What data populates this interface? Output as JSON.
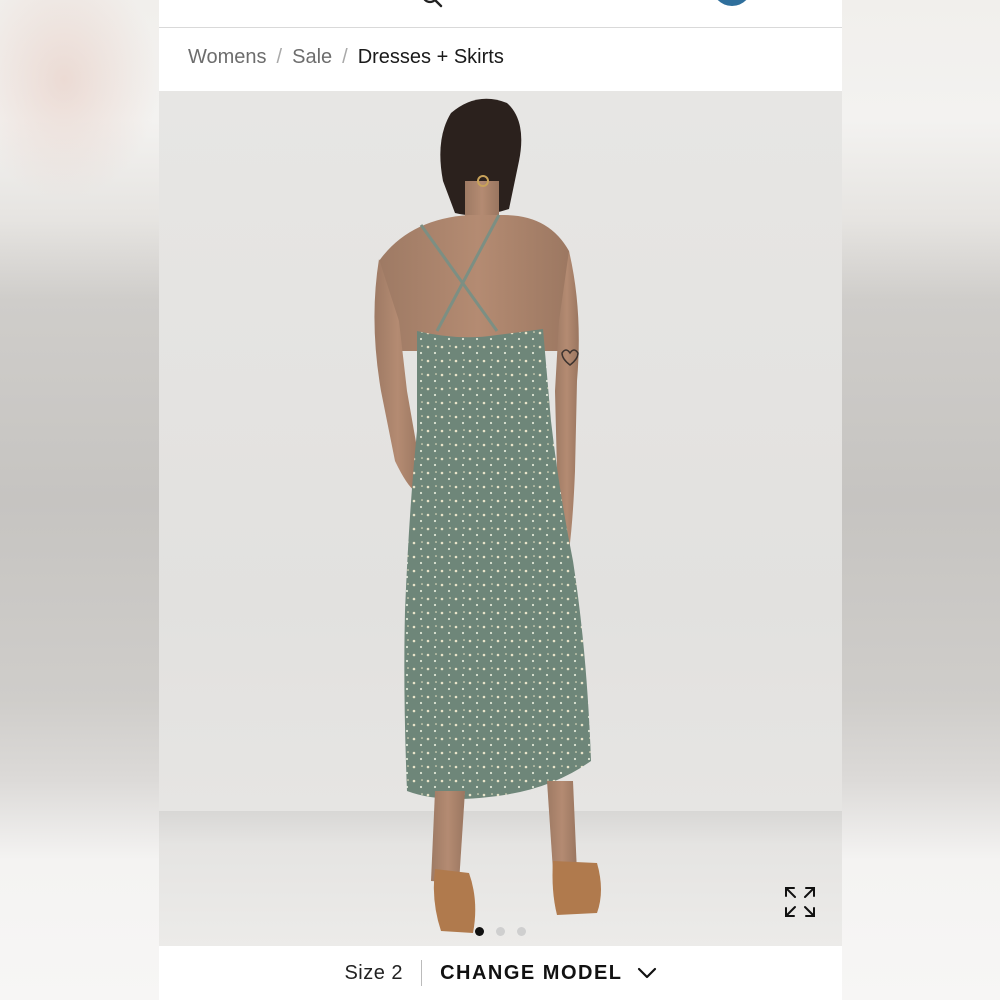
{
  "breadcrumb": {
    "items": [
      {
        "label": "Womens"
      },
      {
        "label": "Sale"
      },
      {
        "label": "Dresses + Skirts"
      }
    ],
    "separator": "/"
  },
  "gallery": {
    "image_count": 3,
    "active_index": 0,
    "icons": {
      "expand": "expand-icon"
    }
  },
  "model_selector": {
    "size_label": "Size 2",
    "change_label": "CHANGE MODEL",
    "icon": "chevron-down-icon"
  },
  "header": {
    "icons": {
      "search": "search-icon",
      "account": "account-icon"
    }
  },
  "colors": {
    "account_accent": "#2f6f9c",
    "dress": "#6e8679",
    "background": "#e4e3e1"
  }
}
